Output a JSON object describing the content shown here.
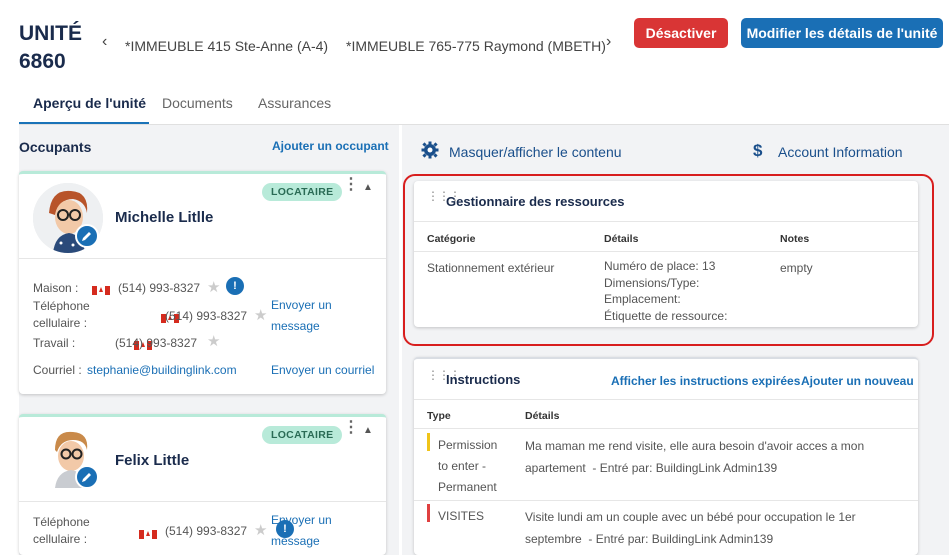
{
  "header": {
    "unit_line1": "UNITÉ",
    "unit_line2": "6860",
    "breadcrumb_prev": "*IMMEUBLE 415 Ste-Anne (A-4)",
    "breadcrumb_next": "*IMMEUBLE 765-775 Raymond (MBETH)",
    "deactivate_label": "Désactiver",
    "edit_label": "Modifier les détails de l'unité",
    "colors": {
      "deactivate": "#d93535",
      "edit": "#1a6fb5"
    }
  },
  "tabs": [
    "Aperçu de l'unité",
    "Documents",
    "Assurances"
  ],
  "occupants": {
    "title": "Occupants",
    "add_label": "Ajouter un occupant",
    "list": [
      {
        "name": "Michelle Litlle",
        "badge": "LOCATAIRE",
        "home_label": "Maison :",
        "home_phone": "(514) 993-8327",
        "cell_label1": "Téléphone",
        "cell_label2": "cellulaire :",
        "cell_phone": "(514) 993-8327",
        "work_label": "Travail :",
        "work_phone": "(514) 993-8327",
        "send_msg1": "Envoyer un",
        "send_msg2": "message",
        "email_label": "Courriel :",
        "email": "stephanie@buildinglink.com",
        "send_email": "Envoyer un courriel"
      },
      {
        "name": "Felix Little",
        "badge": "LOCATAIRE",
        "cell_label1": "Téléphone",
        "cell_label2": "cellulaire :",
        "cell_phone": "(514) 993-8327",
        "send_msg1": "Envoyer un",
        "send_msg2": "message"
      }
    ]
  },
  "toolbar": {
    "toggle_label": "Masquer/afficher le contenu",
    "account_label": "Account Information"
  },
  "resources": {
    "title": "Gestionnaire des ressources",
    "headers": [
      "Catégorie",
      "Détails",
      "Notes"
    ],
    "row": {
      "category": "Stationnement extérieur",
      "details": [
        "Numéro de place: 13",
        "Dimensions/Type:",
        "Emplacement:",
        "Étiquette de ressource:"
      ],
      "notes": "empty"
    }
  },
  "instructions": {
    "title": "Instructions",
    "expired_label": "Afficher les instructions expirées",
    "add_label": "Ajouter un nouveau",
    "headers": [
      "Type",
      "Détails"
    ],
    "rows": [
      {
        "type_lines": [
          "Permission",
          "to enter -",
          "Permanent"
        ],
        "color": "#f0c419",
        "detail1": "Ma maman me rend visite, elle aura besoin d'avoir acces a mon",
        "detail2": "apartement",
        "entered": "- Entré par: BuildingLink Admin139"
      },
      {
        "type_lines": [
          "VISITES"
        ],
        "color": "#e04040",
        "detail1": "Visite lundi am un couple avec un bébé pour occupation le 1er",
        "detail2": "septembre",
        "entered": "- Entré par: BuildingLink Admin139"
      }
    ]
  }
}
